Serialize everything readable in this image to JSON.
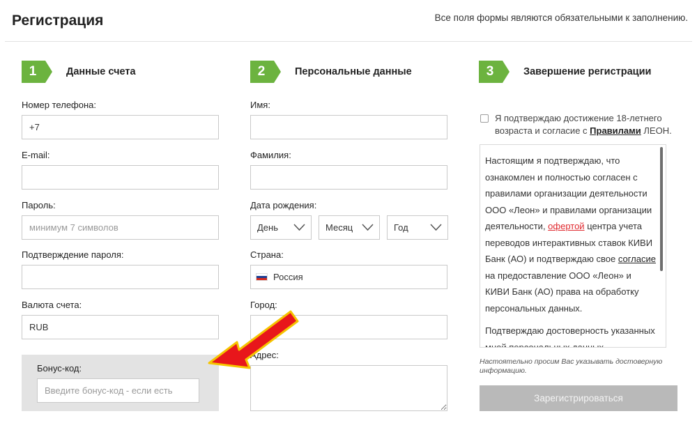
{
  "header": {
    "title": "Регистрация",
    "required_note": "Все поля формы являются обязательными к заполнению."
  },
  "steps": [
    {
      "number": "1",
      "label": "Данные счета"
    },
    {
      "number": "2",
      "label": "Персональные данные"
    },
    {
      "number": "3",
      "label": "Завершение регистрации"
    }
  ],
  "account": {
    "phone": {
      "label": "Номер телефона:",
      "value": "+7"
    },
    "email": {
      "label": "E-mail:",
      "value": ""
    },
    "password": {
      "label": "Пароль:",
      "placeholder": "минимум 7 символов"
    },
    "password_confirm": {
      "label": "Подтверждение пароля:",
      "value": ""
    },
    "currency": {
      "label": "Валюта счета:",
      "value": "RUB"
    },
    "bonus": {
      "label": "Бонус-код:",
      "placeholder": "Введите бонус-код - если есть"
    }
  },
  "personal": {
    "first_name": {
      "label": "Имя:",
      "value": ""
    },
    "last_name": {
      "label": "Фамилия:",
      "value": ""
    },
    "birth_date": {
      "label": "Дата рождения:",
      "day": "День",
      "month": "Месяц",
      "year": "Год"
    },
    "country": {
      "label": "Страна:",
      "value": "Россия"
    },
    "city": {
      "label": "Город:",
      "value": ""
    },
    "address": {
      "label": "Адрес:",
      "value": ""
    }
  },
  "completion": {
    "agree_prefix": "Я подтверждаю достижение 18-летнего возраста и согласие с ",
    "agree_link": "Правилами",
    "agree_suffix": " ЛЕОН.",
    "terms": {
      "p1_part1": "Настоящим я подтверждаю, что ознакомлен и полностью согласен с правилами организации деятельности ООО «Леон» и правилами организации деятельности, ",
      "p1_link1": "офертой",
      "p1_part2": " центра учета переводов интерактивных ставок КИВИ Банк (АО) и подтверждаю свое ",
      "p1_link2": "согласие",
      "p1_part3": " на предоставление ООО «Леон» и КИВИ Банк (АО) права на обработку персональных данных.",
      "p2": "Подтверждаю достоверность указанных мной персональных данных."
    },
    "notice": "Настоятельно просим Вас указывать достоверную информацию.",
    "register_label": "Зарегистрироваться"
  },
  "colors": {
    "accent_green": "#6cb33f",
    "link_red": "#e0282e",
    "button_disabled": "#b9b9b9",
    "arrow_red": "#e8161b",
    "arrow_outline": "#f5c400"
  }
}
